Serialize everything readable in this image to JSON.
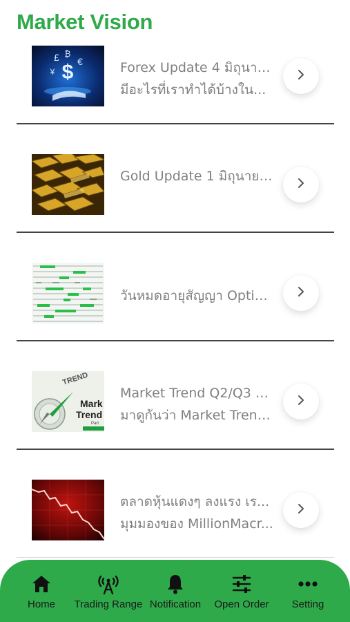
{
  "header": {
    "title": "Market Vision"
  },
  "feed": {
    "items": [
      {
        "line1": "Forex Update 4 มิถุนาย...",
        "line2": "มีอะไรที่เราทำได้บ้างใน...",
        "thumb": "forex-currency-image"
      },
      {
        "line1": "Gold Update 1 มิถุนายน...",
        "line2": "",
        "thumb": "gold-bars-image"
      },
      {
        "line1": "วันหมดอายุสัญญา Optio...",
        "line2": "",
        "thumb": "options-table-image"
      },
      {
        "line1": "Market Trend Q2/Q3 ปี ...",
        "line2": "มาดูกันว่า Market Trend...",
        "thumb": "market-trend-compass-image"
      },
      {
        "line1": "ตลาดหุ้นแดงๆ ลงแรง เร...",
        "line2": "มุมมองของ MillionMacr...",
        "thumb": "red-stock-chart-image"
      }
    ],
    "thumb_texts": {
      "trend_word": "TREND",
      "market_word": "Mark",
      "trend_word2": "Trend",
      "part_word": "Part"
    }
  },
  "bottom_nav": {
    "items": [
      {
        "label": "Home",
        "icon": "home-icon"
      },
      {
        "label": "Trading Range",
        "icon": "antenna-icon"
      },
      {
        "label": "Notification",
        "icon": "bell-icon"
      },
      {
        "label": "Open Order",
        "icon": "sliders-icon"
      },
      {
        "label": "Setting",
        "icon": "more-dots-icon"
      }
    ]
  },
  "colors": {
    "accent": "#2eaa4a",
    "text_muted": "#808080",
    "nav_text": "#1a1a1a"
  }
}
